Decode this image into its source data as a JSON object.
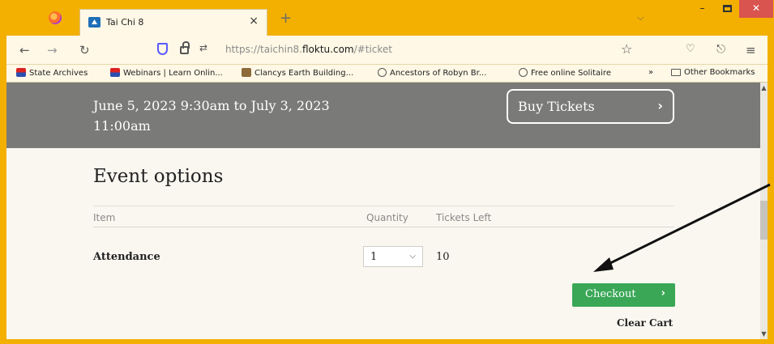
{
  "browser": {
    "tab_title": "Tai Chi 8",
    "tab_close": "×",
    "new_tab": "+",
    "tabs_chevron": "⌵",
    "window_min": "–",
    "window_close": "✕",
    "url_prefix": "https://taichin8.",
    "url_domain": "floktu.com",
    "url_suffix": "/#ticket",
    "perm_icon": "⇄",
    "star": "☆",
    "nav": {
      "back": "←",
      "forward": "→",
      "reload": "↻",
      "pocket": "♡",
      "share": "⎋",
      "menu": "≡"
    }
  },
  "bookmarks": {
    "items": [
      {
        "label": "State Archives",
        "icon": "nsw-icon"
      },
      {
        "label": "Webinars | Learn Onlin...",
        "icon": "nsw-icon"
      },
      {
        "label": "Clancys Earth Building...",
        "icon": "clancys-icon"
      },
      {
        "label": "Ancestors of Robyn Br...",
        "icon": "globe-icon"
      },
      {
        "label": "Free online Solitaire",
        "icon": "globe-icon"
      }
    ],
    "overflow": "»",
    "other": "Other Bookmarks"
  },
  "banner": {
    "date_line1": "June 5, 2023 9:30am to July 3, 2023",
    "date_line2": "11:00am",
    "buy_label": "Buy Tickets",
    "buy_chevron": "›"
  },
  "event": {
    "title": "Event options",
    "headers": {
      "item": "Item",
      "quantity": "Quantity",
      "tickets_left": "Tickets Left"
    },
    "rows": [
      {
        "item": "Attendance",
        "quantity": "1",
        "tickets_left": "10"
      }
    ],
    "checkout_label": "Checkout",
    "checkout_chevron": "›",
    "clear_cart": "Clear Cart"
  },
  "colors": {
    "window_frame": "#f3b000",
    "banner": "#7a7a78",
    "checkout": "#3aa757",
    "close_button": "#d9534f"
  }
}
